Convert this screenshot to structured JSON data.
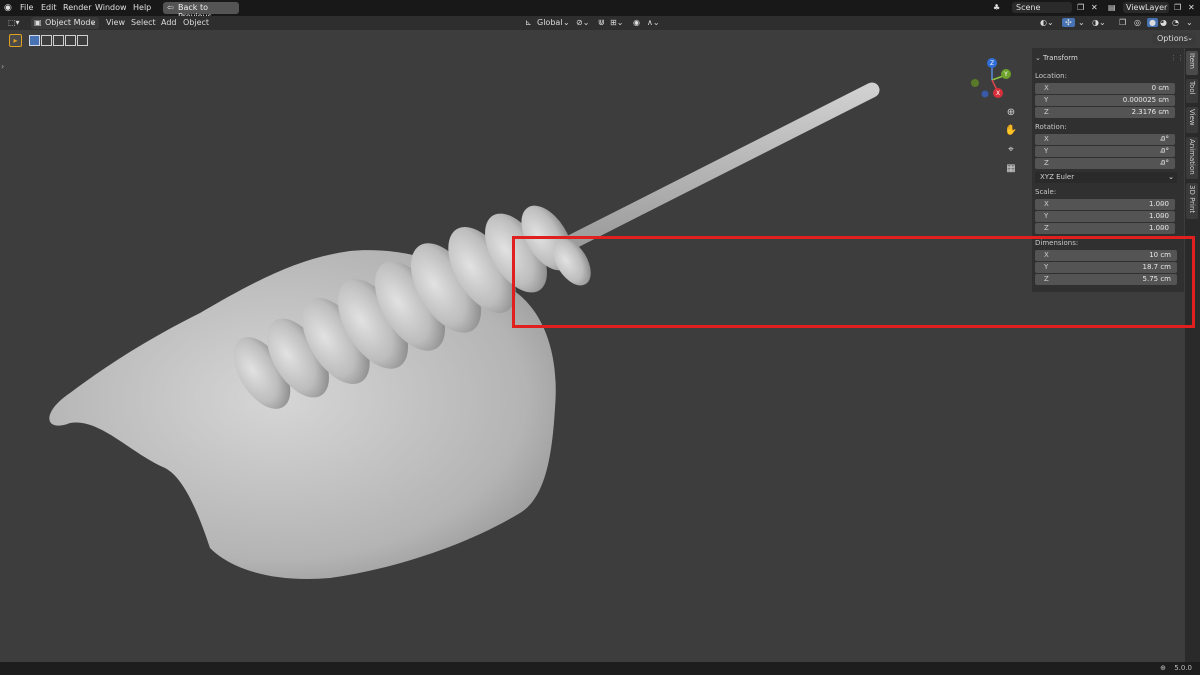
{
  "topbar": {
    "menus": [
      "File",
      "Edit",
      "Render",
      "Window",
      "Help"
    ],
    "back_label": "Back to Previous",
    "scene_label": "Scene",
    "viewlayer_label": "ViewLayer"
  },
  "header": {
    "mode_label": "Object Mode",
    "menus": [
      "View",
      "Select",
      "Add",
      "Object"
    ],
    "transform_orientation": "Global",
    "options_label": "Options"
  },
  "npanel": {
    "section_title": "Transform",
    "location_label": "Location:",
    "location": [
      {
        "axis": "X",
        "value": "0 cm"
      },
      {
        "axis": "Y",
        "value": "0.000025 cm"
      },
      {
        "axis": "Z",
        "value": "2.3176 cm"
      }
    ],
    "rotation_label": "Rotation:",
    "rotation": [
      {
        "axis": "X",
        "value": "0°"
      },
      {
        "axis": "Y",
        "value": "0°"
      },
      {
        "axis": "Z",
        "value": "0°"
      }
    ],
    "rotation_mode": "XYZ Euler",
    "scale_label": "Scale:",
    "scale": [
      {
        "axis": "X",
        "value": "1.000"
      },
      {
        "axis": "Y",
        "value": "1.000"
      },
      {
        "axis": "Z",
        "value": "1.000"
      }
    ],
    "dimensions_label": "Dimensions:",
    "dimensions": [
      {
        "axis": "X",
        "value": "10 cm"
      },
      {
        "axis": "Y",
        "value": "18.7 cm"
      },
      {
        "axis": "Z",
        "value": "5.75 cm"
      }
    ],
    "tabs": [
      "Item",
      "Tool",
      "View",
      "Animation",
      "3D Print"
    ]
  },
  "gizmo": {
    "x": "X",
    "y": "Y",
    "z": "Z"
  },
  "status": {
    "version": "5.0.0"
  },
  "colors": {
    "highlight": "#e01f1f",
    "viewport": "#3d3d3d"
  }
}
